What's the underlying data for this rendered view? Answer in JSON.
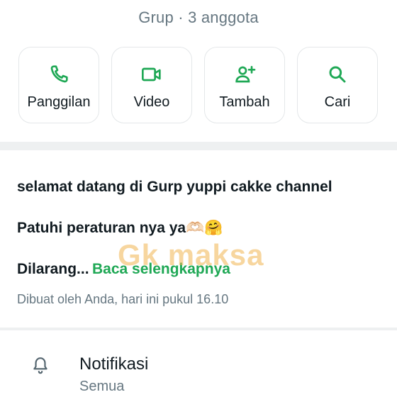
{
  "header": {
    "subtitle": "Grup · 3 anggota"
  },
  "actions": [
    {
      "label": "Panggilan",
      "icon": "phone-icon"
    },
    {
      "label": "Video",
      "icon": "video-icon"
    },
    {
      "label": "Tambah",
      "icon": "add-person-icon"
    },
    {
      "label": "Cari",
      "icon": "search-icon"
    }
  ],
  "description": {
    "line1": "selamat datang di Gurp yuppi cakke channel",
    "line2": "Patuhi peraturan nya ya🫶🏻🤗",
    "line3_prefix": "Dilarang...",
    "read_more": "Baca selengkapnya",
    "created": "Dibuat oleh Anda, hari ini pukul 16.10"
  },
  "watermark": "Gk maksa",
  "notifications": {
    "title": "Notifikasi",
    "value": "Semua",
    "icon": "bell-icon"
  },
  "colors": {
    "accent": "#1fa855",
    "muted": "#667781",
    "text": "#111b21",
    "watermark": "#f0b450"
  }
}
